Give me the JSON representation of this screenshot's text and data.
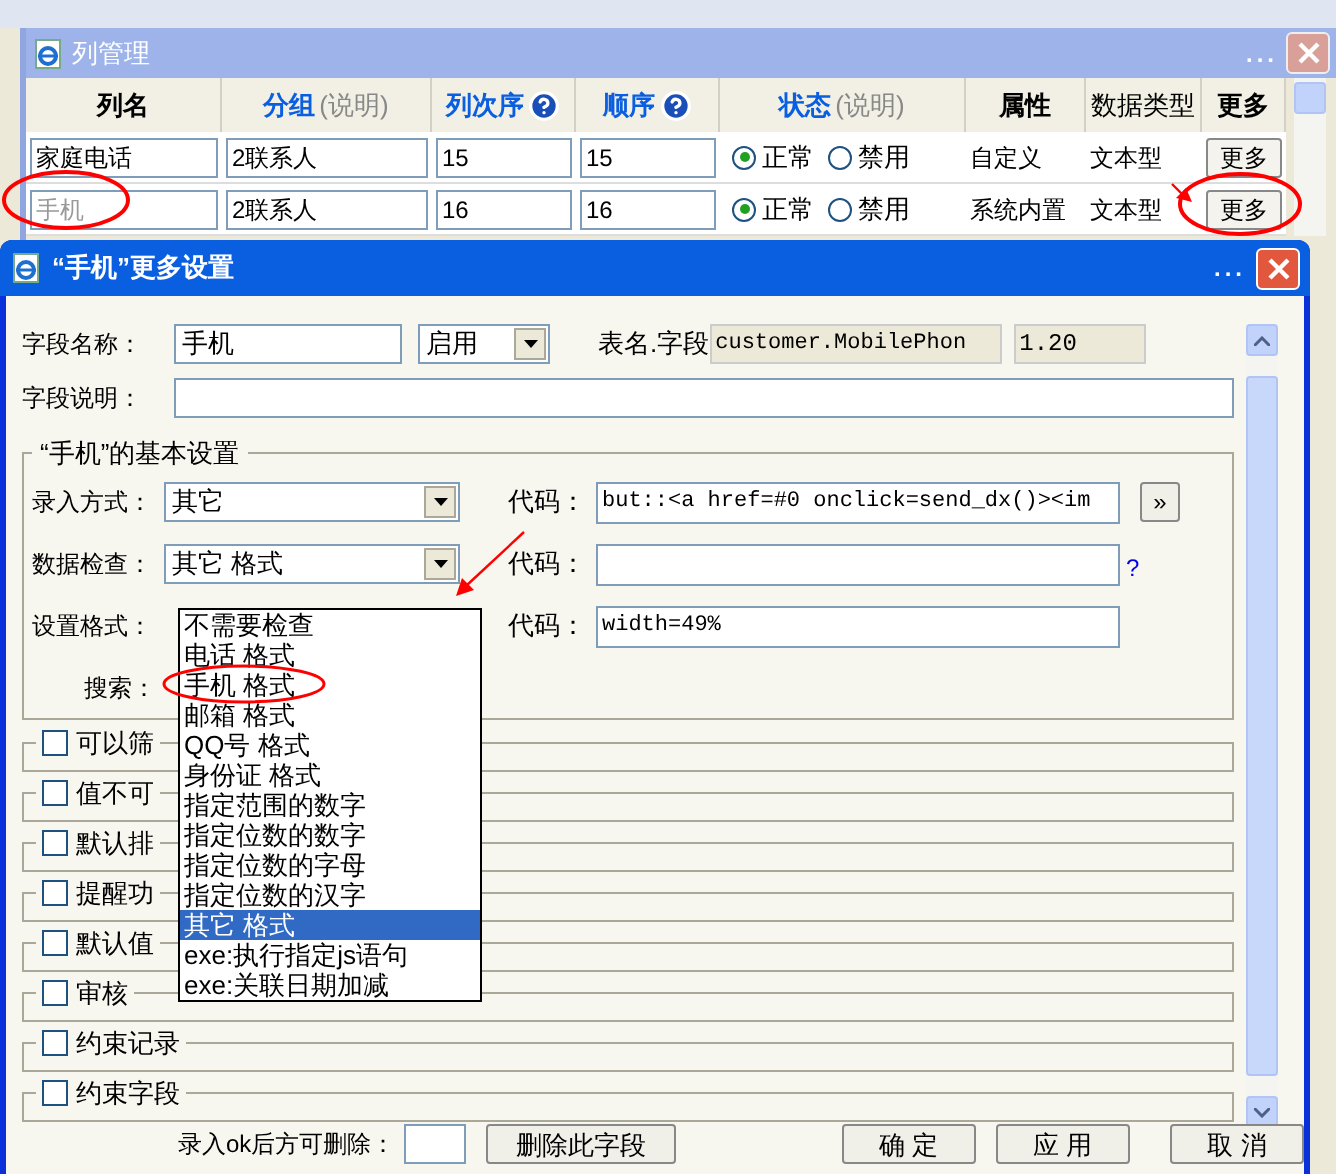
{
  "background_window": {
    "title": "列管理",
    "title_dots": "...",
    "columns": [
      {
        "label": "列名",
        "kind": "plain",
        "help": false
      },
      {
        "label": "分组",
        "note": "(说明)",
        "kind": "link",
        "help": false
      },
      {
        "label": "列次序",
        "kind": "link",
        "help": true
      },
      {
        "label": "顺序",
        "kind": "link",
        "help": true
      },
      {
        "label": "状态",
        "note": "(说明)",
        "kind": "link",
        "help": false
      },
      {
        "label": "属性",
        "kind": "plain",
        "help": false
      },
      {
        "label": "数据类型",
        "kind": "normal",
        "help": false
      },
      {
        "label": "更多",
        "kind": "plain",
        "help": false
      }
    ],
    "rows": [
      {
        "name": "家庭电话",
        "dimmed": false,
        "group": "2联系人",
        "col_order": "15",
        "order": "15",
        "status": [
          {
            "label": "正常",
            "selected": true
          },
          {
            "label": "禁用",
            "selected": false
          }
        ],
        "attribute": "自定义",
        "data_type": "文本型",
        "more": "更多"
      },
      {
        "name": "手机",
        "dimmed": true,
        "group": "2联系人",
        "col_order": "16",
        "order": "16",
        "status": [
          {
            "label": "正常",
            "selected": true
          },
          {
            "label": "禁用",
            "selected": false
          }
        ],
        "attribute": "系统内置",
        "data_type": "文本型",
        "more": "更多"
      }
    ]
  },
  "dialog": {
    "title": "“手机”更多设置",
    "title_dots": "...",
    "field_name": {
      "label": "字段名称：",
      "value": "手机",
      "select": "启用"
    },
    "table_field": {
      "label": "表名.字段",
      "value": "customer.MobilePhon",
      "version": "1.20"
    },
    "description": {
      "label": "字段说明："
    },
    "basic": {
      "legend": "“手机”的基本设置",
      "rows": [
        {
          "label": "录入方式：",
          "select": "其它",
          "code_label": "代码：",
          "code": "but::<a href=#0 onclick=send_dx()><im",
          "suffix": {
            "kind": "button",
            "text": "»"
          }
        },
        {
          "label": "数据检查：",
          "select": "其它 格式",
          "code_label": "代码：",
          "code": "",
          "suffix": {
            "kind": "help",
            "text": "?"
          }
        },
        {
          "label": "设置格式：",
          "code_label": "代码：",
          "code": "width=49%"
        },
        {
          "label": "搜索："
        }
      ]
    },
    "dropdown": [
      {
        "label": "不需要检查",
        "selected": false
      },
      {
        "label": "电话 格式",
        "selected": false
      },
      {
        "label": "手机 格式",
        "selected": false
      },
      {
        "label": "邮箱 格式",
        "selected": false
      },
      {
        "label": "QQ号 格式",
        "selected": false
      },
      {
        "label": "身份证 格式",
        "selected": false
      },
      {
        "label": "指定范围的数字",
        "selected": false
      },
      {
        "label": "指定位数的数字",
        "selected": false
      },
      {
        "label": "指定位数的字母",
        "selected": false
      },
      {
        "label": "指定位数的汉字",
        "selected": false
      },
      {
        "label": "其它 格式",
        "selected": true
      },
      {
        "label": "exe:执行指定js语句",
        "selected": false
      },
      {
        "label": "exe:关联日期加减",
        "selected": false
      }
    ],
    "sections": [
      {
        "label": "可以筛",
        "checked": false
      },
      {
        "label": "值不可",
        "checked": false
      },
      {
        "label": "默认排",
        "checked": false
      },
      {
        "label": "提醒功",
        "checked": false
      },
      {
        "label": "默认值",
        "checked": false
      },
      {
        "label": "审核",
        "checked": false
      },
      {
        "label": "约束记录",
        "checked": false
      },
      {
        "label": "约束字段",
        "checked": false
      }
    ],
    "footer": {
      "delete_label": "录入ok后方可删除：",
      "delete_button": "删除此字段",
      "buttons": [
        "确 定",
        "应 用",
        "取 消"
      ]
    }
  }
}
